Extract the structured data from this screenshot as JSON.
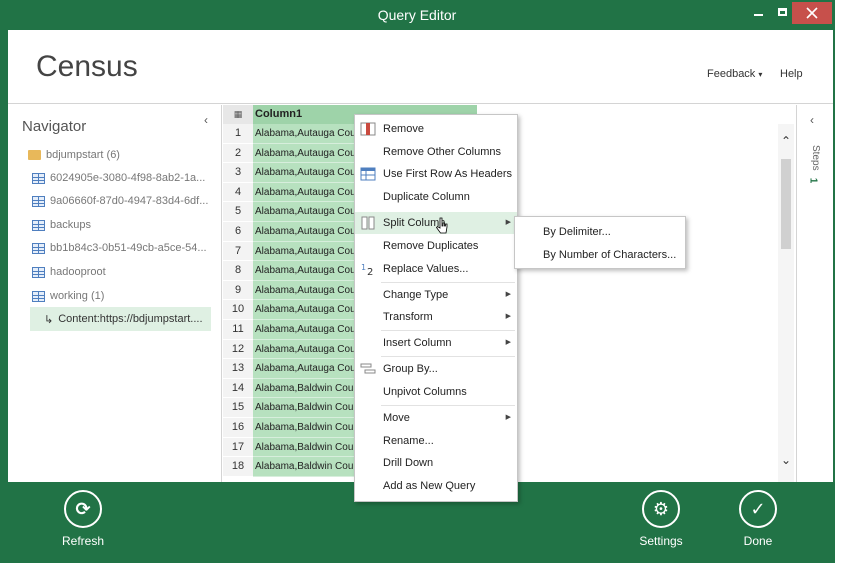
{
  "window": {
    "title": "Query Editor"
  },
  "header": {
    "app_title": "Census",
    "feedback_label": "Feedback",
    "help_label": "Help"
  },
  "navigator": {
    "title": "Navigator",
    "items": [
      {
        "label": "bdjumpstart (6)",
        "icon": "folder-icon"
      },
      {
        "label": "6024905e-3080-4f98-8ab2-1a...",
        "icon": "table-icon"
      },
      {
        "label": "9a06660f-87d0-4947-83d4-6df...",
        "icon": "table-icon"
      },
      {
        "label": "backups",
        "icon": "table-icon"
      },
      {
        "label": "bb1b84c3-0b51-49cb-a5ce-54...",
        "icon": "table-icon"
      },
      {
        "label": "hadooproot",
        "icon": "table-icon"
      },
      {
        "label": "working (1)",
        "icon": "table-icon"
      },
      {
        "label": "Content:https://bdjumpstart....",
        "icon": "subitem-arrow-icon"
      }
    ]
  },
  "grid": {
    "column_header": "Column1",
    "rows": [
      {
        "num": "1",
        "value": "Alabama,Autauga Cou"
      },
      {
        "num": "2",
        "value": "Alabama,Autauga Cou"
      },
      {
        "num": "3",
        "value": "Alabama,Autauga Cou"
      },
      {
        "num": "4",
        "value": "Alabama,Autauga Cou"
      },
      {
        "num": "5",
        "value": "Alabama,Autauga Cou"
      },
      {
        "num": "6",
        "value": "Alabama,Autauga Cou"
      },
      {
        "num": "7",
        "value": "Alabama,Autauga Cou"
      },
      {
        "num": "8",
        "value": "Alabama,Autauga Cou"
      },
      {
        "num": "9",
        "value": "Alabama,Autauga Cou"
      },
      {
        "num": "10",
        "value": "Alabama,Autauga Cou"
      },
      {
        "num": "11",
        "value": "Alabama,Autauga Cou"
      },
      {
        "num": "12",
        "value": "Alabama,Autauga Cou"
      },
      {
        "num": "13",
        "value": "Alabama,Autauga Cou"
      },
      {
        "num": "14",
        "value": "Alabama,Baldwin Cou"
      },
      {
        "num": "15",
        "value": "Alabama,Baldwin Cou"
      },
      {
        "num": "16",
        "value": "Alabama,Baldwin Cou"
      },
      {
        "num": "17",
        "value": "Alabama,Baldwin Cou"
      },
      {
        "num": "18",
        "value": "Alabama,Baldwin Cou"
      }
    ]
  },
  "context_menu": {
    "items": [
      {
        "label": "Remove"
      },
      {
        "label": "Remove Other Columns"
      },
      {
        "label": "Use First Row As Headers"
      },
      {
        "label": "Duplicate Column"
      },
      {
        "label": "Split Column"
      },
      {
        "label": "Remove Duplicates"
      },
      {
        "label": "Replace Values..."
      },
      {
        "label": "Change Type"
      },
      {
        "label": "Transform"
      },
      {
        "label": "Insert Column"
      },
      {
        "label": "Group By..."
      },
      {
        "label": "Unpivot Columns"
      },
      {
        "label": "Move"
      },
      {
        "label": "Rename..."
      },
      {
        "label": "Drill Down"
      },
      {
        "label": "Add as New Query"
      }
    ]
  },
  "split_submenu": {
    "items": [
      {
        "label": "By Delimiter..."
      },
      {
        "label": "By Number of Characters..."
      }
    ]
  },
  "steps": {
    "label": "Steps",
    "count": "1"
  },
  "bottom": {
    "refresh_label": "Refresh",
    "settings_label": "Settings",
    "done_label": "Done"
  },
  "colors": {
    "accent": "#217346",
    "selection": "#b7e1bf",
    "close_button": "#c7504b"
  }
}
